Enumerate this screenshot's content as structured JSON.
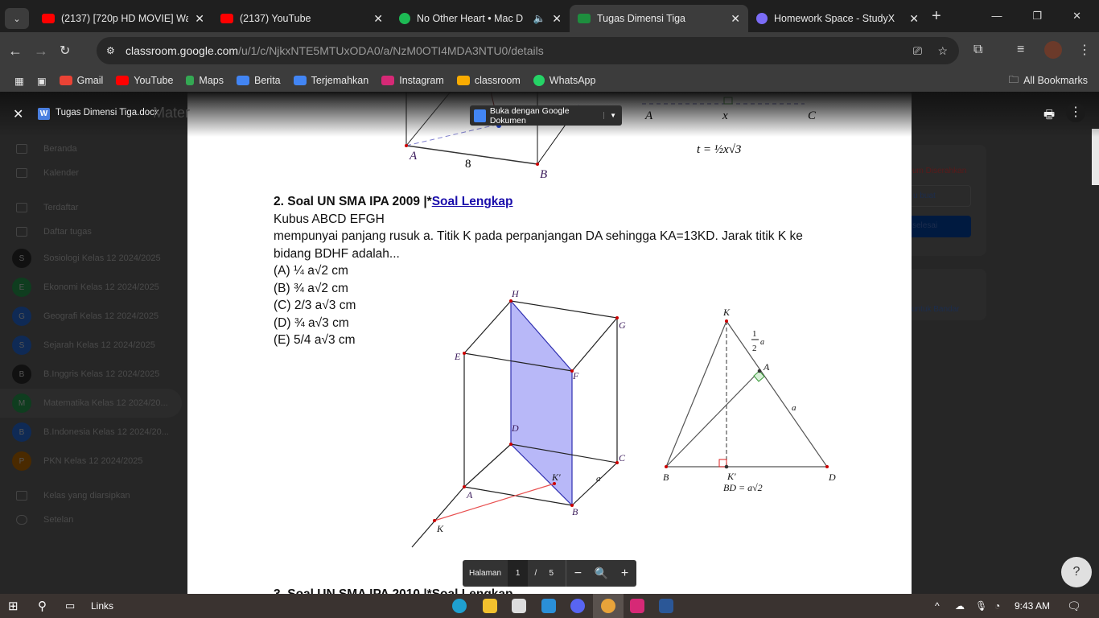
{
  "browser": {
    "tabs": [
      {
        "title": "(2137) [720p HD MOVIE] Wa",
        "icon": "youtube-icon",
        "color": "#ff0000"
      },
      {
        "title": "(2137) YouTube",
        "icon": "youtube-icon",
        "color": "#ff0000"
      },
      {
        "title": "No Other Heart • Mac D",
        "icon": "spotify-icon",
        "color": "#1db954"
      },
      {
        "title": "Tugas Dimensi Tiga",
        "icon": "classroom-icon",
        "color": "#1e8e3e",
        "active": true
      },
      {
        "title": "Homework Space - StudyX",
        "icon": "studyx-icon",
        "color": "#7b6cf6"
      }
    ],
    "url_host": "classroom.google.com",
    "url_path": "/u/1/c/NjkxNTE5MTUxODA0/a/NzM0OTI4MDA3NTU0/details",
    "bookmarks": [
      {
        "label": "Gmail",
        "color": "#ea4335"
      },
      {
        "label": "YouTube",
        "color": "#ff0000"
      },
      {
        "label": "Maps",
        "color": "#34a853"
      },
      {
        "label": "Berita",
        "color": "#4285f4"
      },
      {
        "label": "Terjemahkan",
        "color": "#4285f4"
      },
      {
        "label": "Instagram",
        "color": "#d62976"
      },
      {
        "label": "classroom",
        "color": "#f9ab00"
      },
      {
        "label": "WhatsApp",
        "color": "#25d366"
      }
    ],
    "all_bookmarks": "All Bookmarks"
  },
  "viewer": {
    "file_name": "Tugas Dimensi Tiga.docx",
    "bg_title": "Mater",
    "open_with": "Buka dengan Google Dokumen",
    "pager": {
      "label": "Halaman",
      "current": "1",
      "sep": "/",
      "total": "5"
    }
  },
  "sidebar": {
    "top": [
      {
        "label": "Beranda"
      },
      {
        "label": "Kalender"
      }
    ],
    "enrolled": "Terdaftar",
    "todo": "Daftar tugas",
    "classes": [
      {
        "letter": "S",
        "label": "Sosiologi Kelas 12 2024/2025",
        "color": "#111"
      },
      {
        "letter": "E",
        "label": "Ekonomi Kelas 12 2024/2025",
        "color": "#0f3d1f"
      },
      {
        "letter": "G",
        "label": "Geografi Kelas 12 2024/2025",
        "color": "#0f2a55"
      },
      {
        "letter": "S",
        "label": "Sejarah Kelas 12 2024/2025",
        "color": "#0f2a55"
      },
      {
        "letter": "B",
        "label": "B.Inggris Kelas 12 2024/2025",
        "color": "#111"
      },
      {
        "letter": "M",
        "label": "Matematika Kelas 12 2024/20...",
        "color": "#0f3d1f"
      },
      {
        "letter": "B",
        "label": "B.Indonesia Kelas 12 2024/20...",
        "color": "#0f2a55"
      },
      {
        "letter": "P",
        "label": "PKN Kelas 12 2024/2025",
        "color": "#4a2a00"
      }
    ],
    "archived": "Kelas yang diarsipkan",
    "settings": "Setelan"
  },
  "right_panel": {
    "status": "um Diserahkan",
    "add": "u buat",
    "done": "selesai",
    "comment": "untuk Bandar"
  },
  "document": {
    "top_fig": {
      "A": "A",
      "B": "B",
      "edge": "8",
      "A2": "A",
      "x": "x",
      "C": "C",
      "formula": "t = ½x√3"
    },
    "heading": "2. Soal UN SMA IPA 2009 |*",
    "heading_link": "Soal Lengkap",
    "line1": "Kubus ABCD EFGH",
    "line2": "mempunyai panjang rusuk a. Titik K pada perpanjangan DA sehingga KA=13KD. Jarak titik K ke",
    "line3": "bidang BDHF adalah...",
    "options": [
      "(A) ¼ a√2 cm",
      "(B) ¾ a√2 cm",
      "(C) 2/3 a√3 cm",
      "(D) ¾ a√3 cm",
      "(E) 5/4 a√3 cm"
    ],
    "cube_labels": {
      "H": "H",
      "G": "G",
      "E": "E",
      "F": "F",
      "D": "D",
      "C": "C",
      "A": "A",
      "B": "B",
      "K": "K",
      "Kp": "K′",
      "a": "a"
    },
    "tri_labels": {
      "K": "K",
      "A": "A",
      "B": "B",
      "D": "D",
      "Kp": "K′",
      "half": "1",
      "half_den": "2",
      "half_a": "a",
      "a": "a",
      "bd": "BD = a√2"
    },
    "next_heading": "3. Soal UN SMA IPA 2010 |*Soal Lengkap"
  },
  "taskbar": {
    "search": "Links",
    "time": "9:43 AM"
  }
}
